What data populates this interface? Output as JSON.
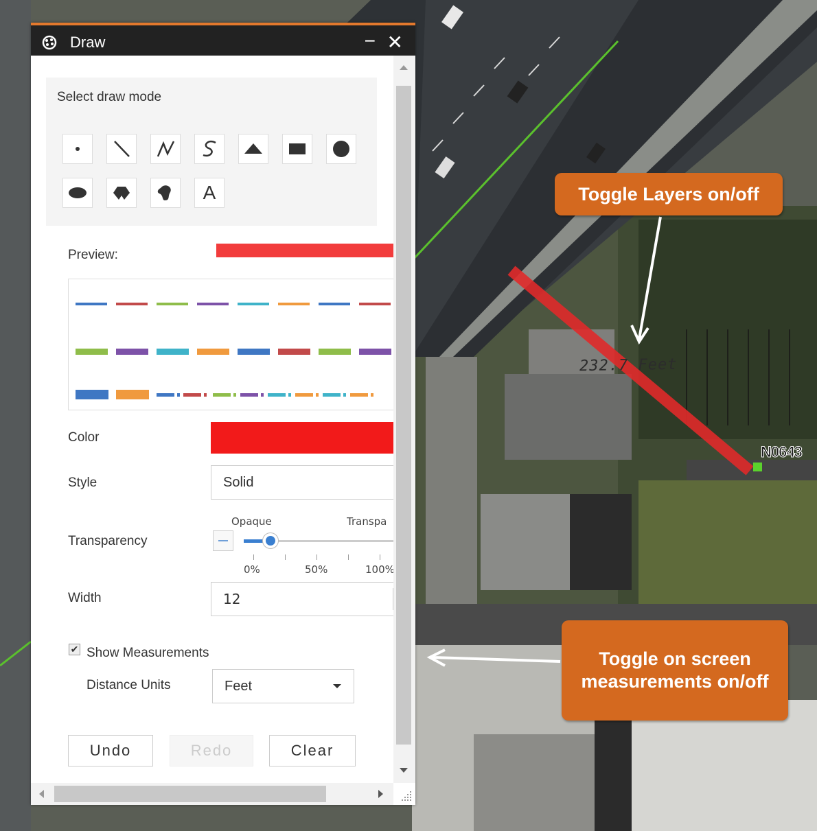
{
  "panel": {
    "title": "Draw",
    "minimize_icon": "minimize-icon",
    "close_icon": "close-icon",
    "app_icon": "draw-widget-icon",
    "minimize_label": "−",
    "close_label": "✕"
  },
  "draw_mode": {
    "title": "Select draw mode",
    "tools": [
      {
        "icon": "point-icon"
      },
      {
        "icon": "line-icon"
      },
      {
        "icon": "polyline-icon"
      },
      {
        "icon": "freehand-line-icon"
      },
      {
        "icon": "triangle-icon"
      },
      {
        "icon": "rectangle-icon"
      },
      {
        "icon": "circle-icon"
      },
      {
        "icon": "ellipse-icon"
      },
      {
        "icon": "polygon-icon"
      },
      {
        "icon": "freehand-polygon-icon"
      },
      {
        "icon": "text-icon",
        "label": "A"
      }
    ]
  },
  "preview": {
    "label": "Preview:",
    "color": "#f23c3c"
  },
  "color": {
    "label": "Color",
    "value": "#f21a1a"
  },
  "style": {
    "label": "Style",
    "value": "Solid"
  },
  "transparency": {
    "label": "Transparency",
    "left_caption": "Opaque",
    "right_caption": "Transpa",
    "ticks": [
      "0%",
      "50%",
      "100%"
    ],
    "value_percent": 10
  },
  "width": {
    "label": "Width",
    "value": "12"
  },
  "measurements": {
    "checkbox_label": "Show Measurements",
    "checked": true,
    "units_label": "Distance Units",
    "units_value": "Feet"
  },
  "buttons": {
    "undo": "Undo",
    "redo": "Redo",
    "clear": "Clear"
  },
  "map": {
    "measurement_text": "232.7 Feet",
    "parcel_label": "N0643",
    "line_color": "#e02a2a",
    "parcel_color": "#5bd12d"
  },
  "callouts": {
    "layers": "Toggle Layers on/off",
    "measurements": "Toggle on screen measurements on/off",
    "color": "#d4691f"
  }
}
